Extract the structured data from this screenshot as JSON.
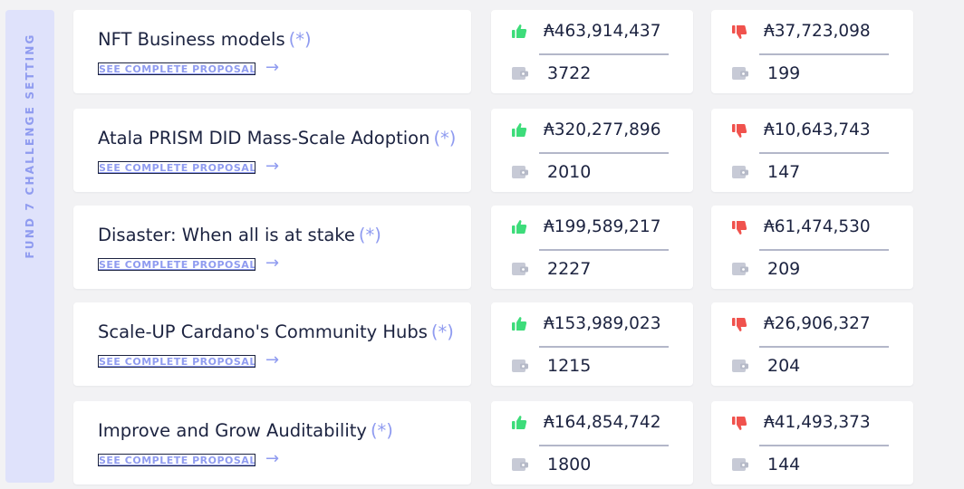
{
  "sidebar": {
    "label": "FUND 7 CHALLENGE SETTING"
  },
  "common": {
    "see_link_label": "SEE COMPLETE PROPOSAL",
    "arrow": "→",
    "asterisk": "(*)"
  },
  "colors": {
    "accent": "#8f9bf0",
    "yes": "#3ddc7a",
    "no": "#f0524d",
    "text": "#1c2340",
    "muted": "#c7cad6"
  },
  "rows": [
    {
      "title": "NFT Business models",
      "yes_amount": "₳463,914,437",
      "yes_count": "3722",
      "no_amount": "₳37,723,098",
      "no_count": "199"
    },
    {
      "title": "Atala PRISM DID Mass-Scale Adoption",
      "yes_amount": "₳320,277,896",
      "yes_count": "2010",
      "no_amount": "₳10,643,743",
      "no_count": "147"
    },
    {
      "title": "Disaster: When all is at stake",
      "yes_amount": "₳199,589,217",
      "yes_count": "2227",
      "no_amount": "₳61,474,530",
      "no_count": "209"
    },
    {
      "title": "Scale-UP Cardano's Community Hubs",
      "yes_amount": "₳153,989,023",
      "yes_count": "1215",
      "no_amount": "₳26,906,327",
      "no_count": "204"
    },
    {
      "title": "Improve and Grow Auditability",
      "yes_amount": "₳164,854,742",
      "yes_count": "1800",
      "no_amount": "₳41,493,373",
      "no_count": "144"
    }
  ]
}
